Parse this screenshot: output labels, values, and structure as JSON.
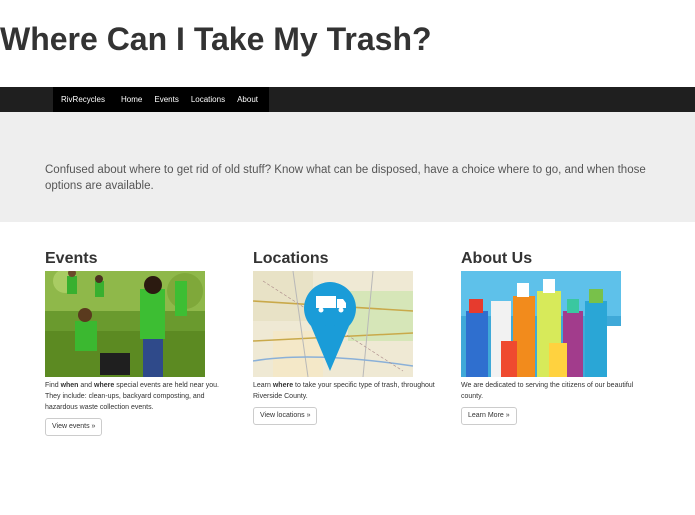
{
  "navbar": {
    "brand": "RivRecycles",
    "links": [
      "Home",
      "Events",
      "Locations",
      "About"
    ]
  },
  "jumbotron": {
    "heading": "Where Can I Take My Trash?",
    "lead": "Confused about where to get rid of old stuff?  Know what can be disposed, have a choice where to go, and when those options are available."
  },
  "columns": [
    {
      "heading": "Events",
      "text_pre": "Find ",
      "text_b1": "when",
      "text_mid": " and ",
      "text_b2": "where",
      "text_post": " special events are held near you. They include: clean-ups, backyard composting, and hazardous waste collection events.",
      "button": "View events »",
      "image": "volunteers-cleanup-photo"
    },
    {
      "heading": "Locations",
      "text_pre": "Learn ",
      "text_b1": "where",
      "text_post": " to take your specific type of trash, throughout Riverside County.",
      "button": "View locations »",
      "image": "map-with-truck-pin"
    },
    {
      "heading": "About Us",
      "text": "We are dedicated to serving the citizens of our beautiful county.",
      "button": "Learn More »",
      "image": "cleaning-bottles-photo"
    }
  ],
  "colors": {
    "navbar": "#000000",
    "jumbotron": "#eeeeee",
    "pin": "#1a9cd8"
  }
}
